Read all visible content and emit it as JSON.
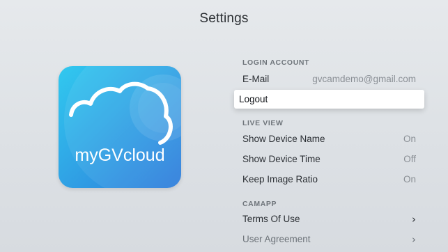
{
  "page": {
    "title": "Settings"
  },
  "app_icon": {
    "name": "myGVcloud",
    "icon": "cloud-icon",
    "colors": {
      "gradient_top": "#2fc6ee",
      "gradient_bottom": "#2f7fdc",
      "text": "#ffffff"
    }
  },
  "sections": {
    "login_account": {
      "header": "LOGIN ACCOUNT",
      "email": {
        "label": "E-Mail",
        "value": "gvcamdemo@gmail.com"
      },
      "logout": {
        "label": "Logout"
      }
    },
    "live_view": {
      "header": "LIVE VIEW",
      "show_device_name": {
        "label": "Show Device Name",
        "value": "On"
      },
      "show_device_time": {
        "label": "Show Device Time",
        "value": "Off"
      },
      "keep_image_ratio": {
        "label": "Keep Image Ratio",
        "value": "On"
      }
    },
    "camapp": {
      "header": "CAMAPP",
      "terms_of_use": {
        "label": "Terms Of Use",
        "icon": "chevron-right-icon"
      },
      "user_agreement": {
        "label": "User Agreement",
        "icon": "chevron-right-icon"
      }
    }
  },
  "colors": {
    "background": "#e2e5e8",
    "focus_row": "#ffffff",
    "value_text": "#8a8f95",
    "section_header": "#6f757b"
  }
}
